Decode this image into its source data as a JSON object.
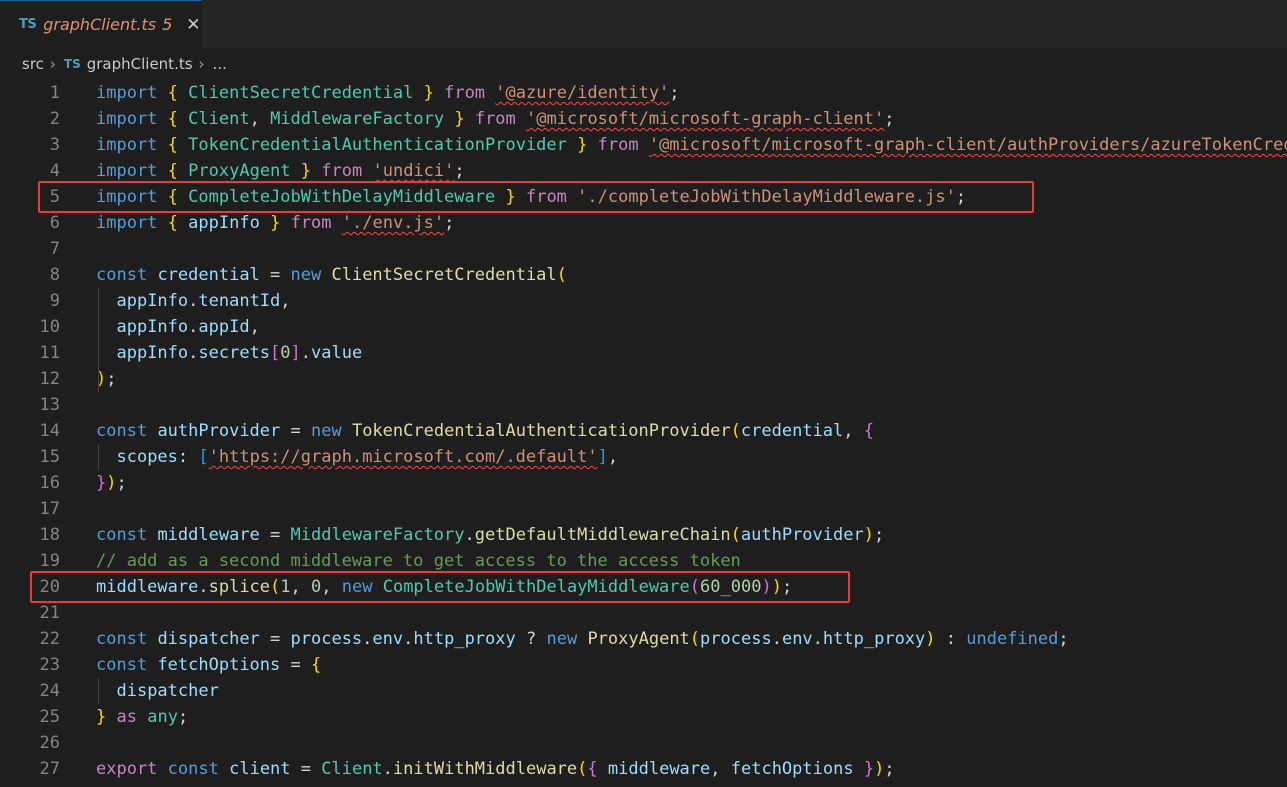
{
  "tab": {
    "icon": "TS",
    "title": "graphClient.ts",
    "problem_count": "5",
    "close_symbol": "✕"
  },
  "breadcrumb": {
    "folder": "src",
    "file_icon": "TS",
    "file": "graphClient.ts",
    "ellipsis": "..."
  },
  "colors": {
    "keyword": "#569cd6",
    "control": "#c586c0",
    "variable": "#9cdcfe",
    "class": "#4ec9b0",
    "function": "#dcdcaa",
    "string": "#ce9178",
    "number": "#b5cea8",
    "comment": "#6a9955",
    "highlight": "#e8393b"
  },
  "highlighted_lines": [
    5,
    20
  ],
  "lines": [
    {
      "n": "1",
      "tokens": [
        [
          "kw",
          "import"
        ],
        [
          "punc",
          " "
        ],
        [
          "p1",
          "{"
        ],
        [
          "punc",
          " "
        ],
        [
          "cls",
          "ClientSecretCredential"
        ],
        [
          "punc",
          " "
        ],
        [
          "p1",
          "}"
        ],
        [
          "punc",
          " "
        ],
        [
          "ctl",
          "from"
        ],
        [
          "punc",
          " "
        ],
        [
          "str err",
          "'@azure/identity'"
        ],
        [
          "punc",
          ";"
        ]
      ]
    },
    {
      "n": "2",
      "tokens": [
        [
          "kw",
          "import"
        ],
        [
          "punc",
          " "
        ],
        [
          "p1",
          "{"
        ],
        [
          "punc",
          " "
        ],
        [
          "cls",
          "Client"
        ],
        [
          "punc",
          ", "
        ],
        [
          "cls",
          "MiddlewareFactory"
        ],
        [
          "punc",
          " "
        ],
        [
          "p1",
          "}"
        ],
        [
          "punc",
          " "
        ],
        [
          "ctl",
          "from"
        ],
        [
          "punc",
          " "
        ],
        [
          "str err",
          "'@microsoft/microsoft-graph-client'"
        ],
        [
          "punc",
          ";"
        ]
      ]
    },
    {
      "n": "3",
      "tokens": [
        [
          "kw",
          "import"
        ],
        [
          "punc",
          " "
        ],
        [
          "p1",
          "{"
        ],
        [
          "punc",
          " "
        ],
        [
          "cls",
          "TokenCredentialAuthenticationProvider"
        ],
        [
          "punc",
          " "
        ],
        [
          "p1",
          "}"
        ],
        [
          "punc",
          " "
        ],
        [
          "ctl",
          "from"
        ],
        [
          "punc",
          " "
        ],
        [
          "str err",
          "'@microsoft/microsoft-graph-client/authProviders/azureTokenCredentials'"
        ],
        [
          "punc",
          ";"
        ]
      ]
    },
    {
      "n": "4",
      "tokens": [
        [
          "kw",
          "import"
        ],
        [
          "punc",
          " "
        ],
        [
          "p1",
          "{"
        ],
        [
          "punc",
          " "
        ],
        [
          "cls",
          "ProxyAgent"
        ],
        [
          "punc",
          " "
        ],
        [
          "p1",
          "}"
        ],
        [
          "punc",
          " "
        ],
        [
          "ctl",
          "from"
        ],
        [
          "punc",
          " "
        ],
        [
          "str err",
          "'undici'"
        ],
        [
          "punc",
          ";"
        ]
      ]
    },
    {
      "n": "5",
      "tokens": [
        [
          "kw",
          "import"
        ],
        [
          "punc",
          " "
        ],
        [
          "p1",
          "{"
        ],
        [
          "punc",
          " "
        ],
        [
          "cls",
          "CompleteJobWithDelayMiddleware"
        ],
        [
          "punc",
          " "
        ],
        [
          "p1",
          "}"
        ],
        [
          "punc",
          " "
        ],
        [
          "ctl",
          "from"
        ],
        [
          "punc",
          " "
        ],
        [
          "str",
          "'./completeJobWithDelayMiddleware.js'"
        ],
        [
          "punc",
          ";"
        ]
      ]
    },
    {
      "n": "6",
      "tokens": [
        [
          "kw",
          "import"
        ],
        [
          "punc",
          " "
        ],
        [
          "p1",
          "{"
        ],
        [
          "punc",
          " "
        ],
        [
          "id",
          "appInfo"
        ],
        [
          "punc",
          " "
        ],
        [
          "p1",
          "}"
        ],
        [
          "punc",
          " "
        ],
        [
          "ctl",
          "from"
        ],
        [
          "punc",
          " "
        ],
        [
          "str err",
          "'./env.js'"
        ],
        [
          "punc",
          ";"
        ]
      ]
    },
    {
      "n": "7",
      "tokens": []
    },
    {
      "n": "8",
      "tokens": [
        [
          "kw",
          "const"
        ],
        [
          "punc",
          " "
        ],
        [
          "id",
          "credential"
        ],
        [
          "punc",
          " = "
        ],
        [
          "kw",
          "new"
        ],
        [
          "punc",
          " "
        ],
        [
          "fn",
          "ClientSecretCredential"
        ],
        [
          "p1",
          "("
        ]
      ]
    },
    {
      "n": "9",
      "tokens": [
        [
          "punc",
          "  "
        ],
        [
          "id",
          "appInfo"
        ],
        [
          "punc",
          "."
        ],
        [
          "id",
          "tenantId"
        ],
        [
          "punc",
          ","
        ]
      ]
    },
    {
      "n": "10",
      "tokens": [
        [
          "punc",
          "  "
        ],
        [
          "id",
          "appInfo"
        ],
        [
          "punc",
          "."
        ],
        [
          "id",
          "appId"
        ],
        [
          "punc",
          ","
        ]
      ]
    },
    {
      "n": "11",
      "tokens": [
        [
          "punc",
          "  "
        ],
        [
          "id",
          "appInfo"
        ],
        [
          "punc",
          "."
        ],
        [
          "id",
          "secrets"
        ],
        [
          "p2",
          "["
        ],
        [
          "num",
          "0"
        ],
        [
          "p2",
          "]"
        ],
        [
          "punc",
          "."
        ],
        [
          "id",
          "value"
        ]
      ]
    },
    {
      "n": "12",
      "tokens": [
        [
          "p1",
          ")"
        ],
        [
          "punc",
          ";"
        ]
      ]
    },
    {
      "n": "13",
      "tokens": []
    },
    {
      "n": "14",
      "tokens": [
        [
          "kw",
          "const"
        ],
        [
          "punc",
          " "
        ],
        [
          "id",
          "authProvider"
        ],
        [
          "punc",
          " = "
        ],
        [
          "kw",
          "new"
        ],
        [
          "punc",
          " "
        ],
        [
          "fn",
          "TokenCredentialAuthenticationProvider"
        ],
        [
          "p1",
          "("
        ],
        [
          "id",
          "credential"
        ],
        [
          "punc",
          ", "
        ],
        [
          "p2",
          "{"
        ]
      ]
    },
    {
      "n": "15",
      "tokens": [
        [
          "punc",
          "  "
        ],
        [
          "id",
          "scopes"
        ],
        [
          "punc",
          ": "
        ],
        [
          "p3",
          "["
        ],
        [
          "str err",
          "'https://graph.microsoft.com/.default'"
        ],
        [
          "p3",
          "]"
        ],
        [
          "punc",
          ","
        ]
      ]
    },
    {
      "n": "16",
      "tokens": [
        [
          "p2",
          "}"
        ],
        [
          "p1",
          ")"
        ],
        [
          "punc",
          ";"
        ]
      ]
    },
    {
      "n": "17",
      "tokens": []
    },
    {
      "n": "18",
      "tokens": [
        [
          "kw",
          "const"
        ],
        [
          "punc",
          " "
        ],
        [
          "id",
          "middleware"
        ],
        [
          "punc",
          " = "
        ],
        [
          "cls",
          "MiddlewareFactory"
        ],
        [
          "punc",
          "."
        ],
        [
          "fn",
          "getDefaultMiddlewareChain"
        ],
        [
          "p1",
          "("
        ],
        [
          "id",
          "authProvider"
        ],
        [
          "p1",
          ")"
        ],
        [
          "punc",
          ";"
        ]
      ]
    },
    {
      "n": "19",
      "tokens": [
        [
          "cmt",
          "// add as a second middleware to get access to the access token"
        ]
      ]
    },
    {
      "n": "20",
      "tokens": [
        [
          "id",
          "middleware"
        ],
        [
          "punc",
          "."
        ],
        [
          "fn",
          "splice"
        ],
        [
          "p1",
          "("
        ],
        [
          "num",
          "1"
        ],
        [
          "punc",
          ", "
        ],
        [
          "num",
          "0"
        ],
        [
          "punc",
          ", "
        ],
        [
          "kw",
          "new"
        ],
        [
          "punc",
          " "
        ],
        [
          "cls",
          "CompleteJobWithDelayMiddleware"
        ],
        [
          "p2",
          "("
        ],
        [
          "num",
          "60_000"
        ],
        [
          "p2",
          ")"
        ],
        [
          "p1",
          ")"
        ],
        [
          "punc",
          ";"
        ]
      ]
    },
    {
      "n": "21",
      "tokens": []
    },
    {
      "n": "22",
      "tokens": [
        [
          "kw",
          "const"
        ],
        [
          "punc",
          " "
        ],
        [
          "id",
          "dispatcher"
        ],
        [
          "punc",
          " = "
        ],
        [
          "id",
          "process"
        ],
        [
          "punc",
          "."
        ],
        [
          "id",
          "env"
        ],
        [
          "punc",
          "."
        ],
        [
          "id",
          "http_proxy"
        ],
        [
          "punc",
          " ? "
        ],
        [
          "kw",
          "new"
        ],
        [
          "punc",
          " "
        ],
        [
          "fn",
          "ProxyAgent"
        ],
        [
          "p1",
          "("
        ],
        [
          "id",
          "process"
        ],
        [
          "punc",
          "."
        ],
        [
          "id",
          "env"
        ],
        [
          "punc",
          "."
        ],
        [
          "id",
          "http_proxy"
        ],
        [
          "p1",
          ")"
        ],
        [
          "punc",
          " : "
        ],
        [
          "kw",
          "undefined"
        ],
        [
          "punc",
          ";"
        ]
      ]
    },
    {
      "n": "23",
      "tokens": [
        [
          "kw",
          "const"
        ],
        [
          "punc",
          " "
        ],
        [
          "id",
          "fetchOptions"
        ],
        [
          "punc",
          " = "
        ],
        [
          "p1",
          "{"
        ]
      ]
    },
    {
      "n": "24",
      "tokens": [
        [
          "punc",
          "  "
        ],
        [
          "id",
          "dispatcher"
        ]
      ]
    },
    {
      "n": "25",
      "tokens": [
        [
          "p1",
          "}"
        ],
        [
          "punc",
          " "
        ],
        [
          "ctl",
          "as"
        ],
        [
          "punc",
          " "
        ],
        [
          "cls",
          "any"
        ],
        [
          "punc",
          ";"
        ]
      ]
    },
    {
      "n": "26",
      "tokens": []
    },
    {
      "n": "27",
      "tokens": [
        [
          "ctl",
          "export"
        ],
        [
          "punc",
          " "
        ],
        [
          "kw",
          "const"
        ],
        [
          "punc",
          " "
        ],
        [
          "id",
          "client"
        ],
        [
          "punc",
          " = "
        ],
        [
          "cls",
          "Client"
        ],
        [
          "punc",
          "."
        ],
        [
          "fn",
          "initWithMiddleware"
        ],
        [
          "p1",
          "("
        ],
        [
          "p2",
          "{"
        ],
        [
          "punc",
          " "
        ],
        [
          "id",
          "middleware"
        ],
        [
          "punc",
          ", "
        ],
        [
          "id",
          "fetchOptions"
        ],
        [
          "punc",
          " "
        ],
        [
          "p2",
          "}"
        ],
        [
          "p1",
          ")"
        ],
        [
          "punc",
          ";"
        ]
      ]
    }
  ]
}
